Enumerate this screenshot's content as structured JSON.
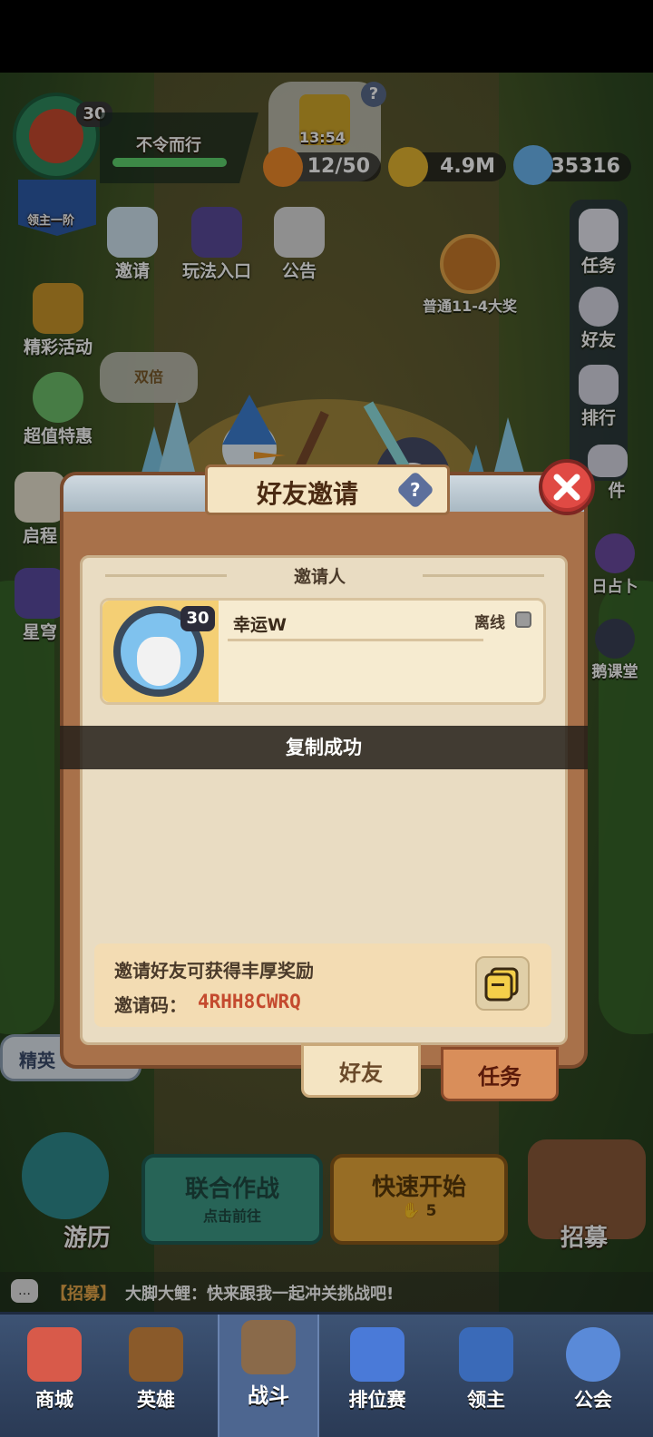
{
  "player": {
    "level": "30",
    "name": "不令而行",
    "rank_label": "领主一阶"
  },
  "timer": {
    "value": "13:54",
    "help": "?"
  },
  "resources": {
    "energy": "12/50",
    "gold": "4.9M",
    "gems": "35316"
  },
  "top_actions": [
    {
      "label": "邀请",
      "icon": "snowman-icon"
    },
    {
      "label": "玩法入口",
      "icon": "gamepad-icon"
    },
    {
      "label": "公告",
      "icon": "megaphone-icon"
    }
  ],
  "stage_reward": "普通11-4大奖",
  "left_menu": [
    {
      "label": "精彩活动",
      "icon": "chest-icon"
    },
    {
      "label": "超值特惠",
      "icon": "clock-icon"
    },
    {
      "label": "启程",
      "icon": "wing-icon"
    },
    {
      "label": "星穹",
      "icon": "star-icon"
    }
  ],
  "right_menu": [
    {
      "label": "任务",
      "icon": "clipboard-icon"
    },
    {
      "label": "好友",
      "icon": "friend-icon"
    },
    {
      "label": "排行",
      "icon": "podium-icon"
    },
    {
      "label": "件",
      "icon": "mail-icon"
    },
    {
      "label": "日占卜",
      "icon": "crystal-icon"
    },
    {
      "label": "鹅课堂",
      "icon": "penguin-icon"
    }
  ],
  "bonus_bubble": "双倍",
  "dialog": {
    "title": "好友邀请",
    "help": "?",
    "section_title": "邀请人",
    "inviter": {
      "level": "30",
      "name": "幸运W",
      "status": "离线"
    },
    "toast": "复制成功",
    "reward_text": "邀请好友可获得丰厚奖励",
    "code_label": "邀请码：",
    "code_value": "4RHH8CWRQ",
    "tabs": [
      "好友",
      "任务"
    ]
  },
  "battle": {
    "coop_title": "联合作战",
    "coop_sub": "点击前往",
    "quick_title": "快速开始",
    "quick_cost": "5",
    "travel": "游历",
    "recruit": "招募",
    "elite": "精英"
  },
  "chat": {
    "channel": "【招募】",
    "message": "大脚大鲤：快来跟我一起冲关挑战吧!"
  },
  "bottom_nav": [
    {
      "label": "商城",
      "icon": "shop-icon"
    },
    {
      "label": "英雄",
      "icon": "hero-card-icon"
    },
    {
      "label": "战斗",
      "icon": "sword-icon"
    },
    {
      "label": "排位赛",
      "icon": "rank-shield-icon"
    },
    {
      "label": "领主",
      "icon": "banner-icon"
    },
    {
      "label": "公会",
      "icon": "guild-icon"
    }
  ],
  "colors": {
    "accent_red": "#e04a44",
    "code_color": "#c44a2e",
    "panel_brown": "#a8714a",
    "nav_blue": "#34496a"
  }
}
